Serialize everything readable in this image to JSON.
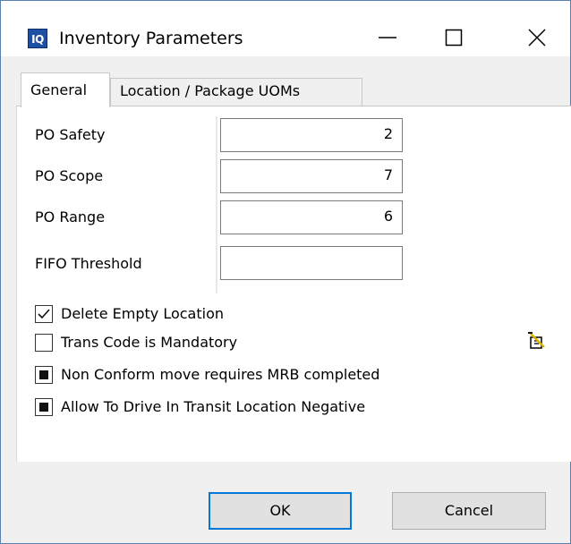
{
  "window": {
    "title": "Inventory Parameters",
    "app_icon_text": "IQ",
    "icons": {
      "app": "iq-app-icon",
      "minimize": "minimize-icon",
      "maximize": "maximize-icon",
      "close": "close-icon"
    }
  },
  "tabs": [
    {
      "label": "General",
      "selected": true
    },
    {
      "label": "Location / Package UOMs",
      "selected": false
    }
  ],
  "fields": [
    {
      "label": "PO Safety",
      "value": "2"
    },
    {
      "label": "PO Scope",
      "value": "7"
    },
    {
      "label": "PO Range",
      "value": "6"
    },
    {
      "label": "FIFO Threshold",
      "value": ""
    }
  ],
  "checkboxes": [
    {
      "label": "Delete Empty Location",
      "state": "checked"
    },
    {
      "label": "Trans Code is Mandatory",
      "state": "unchecked"
    },
    {
      "label": "Non Conform move requires MRB completed",
      "state": "indeterminate"
    },
    {
      "label": "Allow To Drive In Transit Location Negative",
      "state": "indeterminate"
    }
  ],
  "side_icon": "edit-note-icon",
  "buttons": {
    "ok": "OK",
    "cancel": "Cancel"
  },
  "colors": {
    "accent": "#0078d7",
    "dialog_bg": "#f0f0f0",
    "app_icon": "#1d4fa3"
  }
}
